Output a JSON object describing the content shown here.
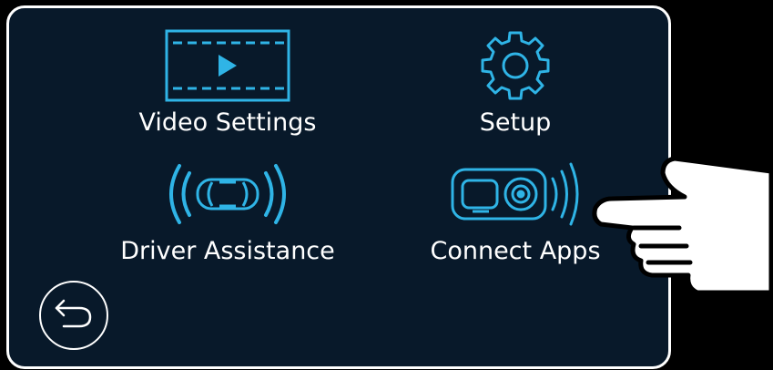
{
  "menu": {
    "items": [
      {
        "label": "Video Settings",
        "icon": "video-settings-icon"
      },
      {
        "label": "Setup",
        "icon": "gear-icon"
      },
      {
        "label": "Driver Assistance",
        "icon": "car-sensor-icon"
      },
      {
        "label": "Connect Apps",
        "icon": "dashcam-wifi-icon"
      }
    ]
  },
  "back": {
    "icon": "back-arrow-icon"
  },
  "overlay": {
    "icon": "pointing-hand-icon"
  },
  "colors": {
    "background": "#000000",
    "screen": "#08192a",
    "accent": "#2fb4e6",
    "text": "#ffffff"
  }
}
